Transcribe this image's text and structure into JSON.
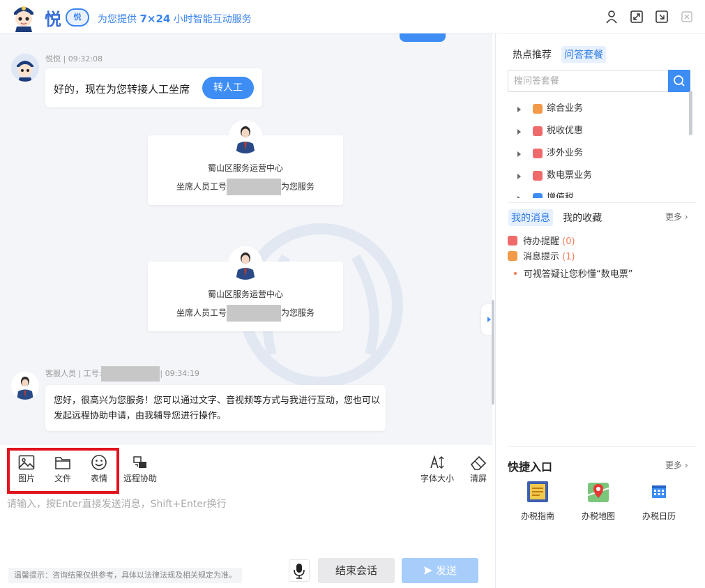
{
  "header": {
    "brand": "悦",
    "badge": "悦",
    "slogan_prefix": "为您提供 ",
    "slogan_bold": "7×24",
    "slogan_suffix": " 小时智能互动服务"
  },
  "chat": {
    "bot_meta": "悦悦 | 09:32:08",
    "bot_message": "好的，现在为您转接人工坐席",
    "transfer_label": "转人工",
    "cards": [
      {
        "center": "蜀山区服务运营中心",
        "line_prefix": "坐席人员工号",
        "line_suffix": "为您服务"
      },
      {
        "center": "蜀山区服务运营中心",
        "line_prefix": "坐席人员工号",
        "line_suffix": "为您服务"
      }
    ],
    "agent_meta_prefix": "客服人员 | 工号:",
    "agent_meta_suffix": "| 09:34:19",
    "agent_message": "您好，很高兴为您服务！您可以通过文字、音视频等方式与我进行互动，您也可以发起远程协助申请，由我辅导您进行操作。"
  },
  "toolbar": {
    "image": "图片",
    "file": "文件",
    "emoji": "表情",
    "remote": "远程协助",
    "font_size": "字体大小",
    "clear": "清屏"
  },
  "input": {
    "placeholder": "请输入，按Enter直接发送消息，Shift+Enter换行",
    "tip": "温馨提示：咨询结果仅供参考，具体以法律法规及相关规定为准。",
    "end_label": "结束会话",
    "send_label": "发送"
  },
  "sidebar": {
    "tabs": [
      "热点推荐",
      "问答套餐"
    ],
    "search_placeholder": "搜问答套餐",
    "tree": [
      {
        "label": "综合业务",
        "color": "#f29a4a"
      },
      {
        "label": "税收优惠",
        "color": "#ef6b6b"
      },
      {
        "label": "涉外业务",
        "color": "#ef6b6b"
      },
      {
        "label": "数电票业务",
        "color": "#ef6b6b"
      },
      {
        "label": "增值税",
        "color": "#3d8df5"
      }
    ],
    "msg_tabs": [
      "我的消息",
      "我的收藏"
    ],
    "more": "更多",
    "todo_label": "待办提醒",
    "todo_count": "(0)",
    "notice_label": "消息提示",
    "notice_count": "(1)",
    "message": "可视答疑让您秒懂“数电票”",
    "quick_title": "快捷入口",
    "quick_more": "更多",
    "quick_items": [
      "办税指南",
      "办税地图",
      "办税日历"
    ]
  }
}
